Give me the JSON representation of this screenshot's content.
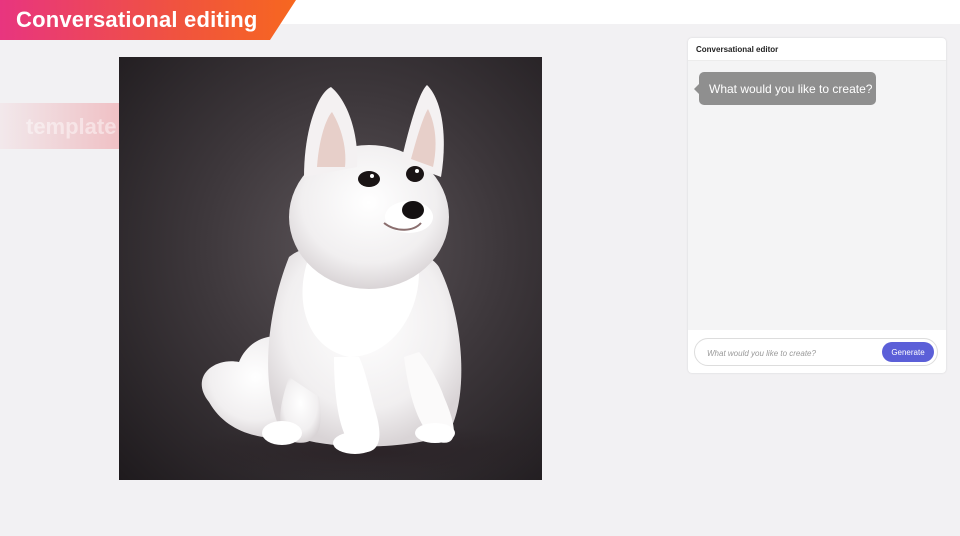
{
  "header": {
    "title": "Conversational editing",
    "ghost_text": "template"
  },
  "canvas": {
    "image_description": "white-puppy-photo"
  },
  "editor": {
    "title": "Conversational editor",
    "messages": [
      {
        "role": "assistant",
        "text": "What would you like to create?"
      }
    ],
    "prompt_placeholder": "What would you like to create?",
    "generate_label": "Generate"
  },
  "colors": {
    "banner_start": "#e8357f",
    "banner_end": "#f7671f",
    "generate_button": "#5b5fd8",
    "bubble": "#8f8f8f"
  }
}
